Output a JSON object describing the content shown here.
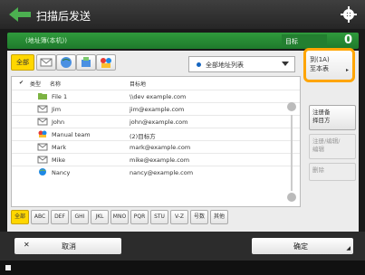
{
  "header": {
    "title": "扫描后发送"
  },
  "destination_bar": {
    "address": "(地址簿(本机))",
    "count_label": "目标",
    "count": "0"
  },
  "toolbar": {
    "all_label": "全部"
  },
  "address_book_select": {
    "value": "全部地址列表"
  },
  "register_button": {
    "line1": "到(1A)",
    "line2": "至本表"
  },
  "list_header": {
    "check": "✔",
    "type": "类型",
    "name": "名称",
    "destination": "目标地"
  },
  "list_rows": [
    {
      "icon": "folder-icon",
      "name": "File 1",
      "dest": "\\\\dev example.com"
    },
    {
      "icon": "email-icon",
      "name": "Jim",
      "dest": "jim@example.com"
    },
    {
      "icon": "email-icon",
      "name": "John",
      "dest": "john@example.com"
    },
    {
      "icon": "group-icon",
      "name": "Manual team",
      "dest": "(2)目标方"
    },
    {
      "icon": "email-icon",
      "name": "Mark",
      "dest": "mark@example.com"
    },
    {
      "icon": "email-icon",
      "name": "Mike",
      "dest": "mike@example.com"
    },
    {
      "icon": "fax-icon",
      "name": "Nancy",
      "dest": "nancy@example.com"
    }
  ],
  "side_buttons": {
    "details": {
      "line1": "注册备",
      "line2": "择目方"
    },
    "edit": {
      "line1": "注册/编辑/",
      "line2": "编辑"
    },
    "delete": {
      "line1": "删除"
    }
  },
  "index_tabs": [
    "全部",
    "ABC",
    "DEF",
    "GHI",
    "JKL",
    "MNO",
    "PQR",
    "STU",
    "V-Z",
    "号数",
    "其他"
  ],
  "footer": {
    "cancel_label": "取消",
    "ok_label": "确定"
  },
  "colors": {
    "accent_green": "#2f9a3c",
    "highlight_orange": "#ffa500",
    "active_tab": "#ffd700"
  }
}
